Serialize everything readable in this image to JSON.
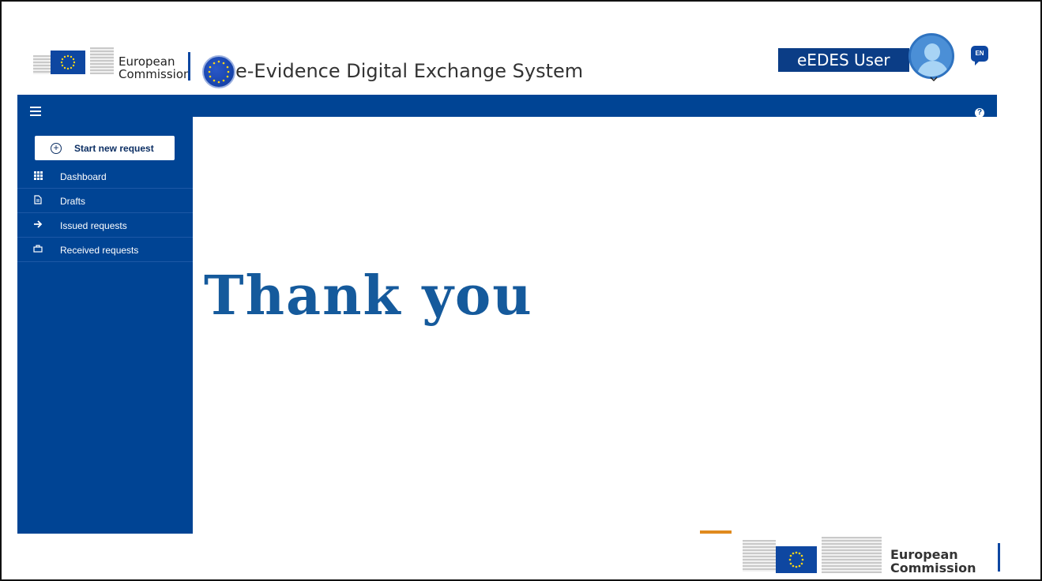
{
  "header": {
    "ec_logo_line1": "European",
    "ec_logo_line2": "Commission",
    "app_title": "e-Evidence Digital Exchange System",
    "user_label": "eEDES User",
    "language": "EN"
  },
  "sidebar": {
    "new_request_label": "Start new request",
    "items": [
      {
        "label": "Dashboard",
        "icon": "grid-icon"
      },
      {
        "label": "Drafts",
        "icon": "document-icon"
      },
      {
        "label": "Issued requests",
        "icon": "arrow-right-icon"
      },
      {
        "label": "Received requests",
        "icon": "briefcase-icon"
      }
    ]
  },
  "main": {
    "message": "Thank you"
  },
  "footer": {
    "ec_logo_line1": "European",
    "ec_logo_line2": "Commission"
  },
  "colors": {
    "primary": "#004494",
    "title_text": "#155a9c"
  }
}
